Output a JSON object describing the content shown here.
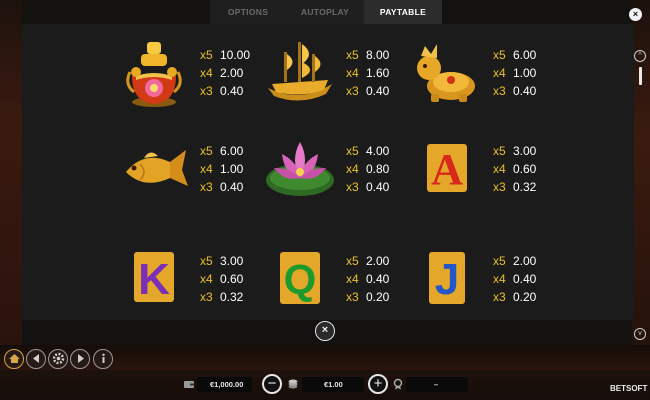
{
  "tabs": [
    {
      "label": "OPTIONS",
      "active": false
    },
    {
      "label": "AUTOPLAY",
      "active": false
    },
    {
      "label": "PAYTABLE",
      "active": true
    }
  ],
  "close_label": "×",
  "scroll": {
    "up": "^",
    "down": "v"
  },
  "paytable": [
    {
      "symbol": "gold-treasure-pot",
      "pays": [
        {
          "mult": "x5",
          "amount": "10.00"
        },
        {
          "mult": "x4",
          "amount": "2.00"
        },
        {
          "mult": "x3",
          "amount": "0.40"
        }
      ]
    },
    {
      "symbol": "golden-ship",
      "pays": [
        {
          "mult": "x5",
          "amount": "8.00"
        },
        {
          "mult": "x4",
          "amount": "1.60"
        },
        {
          "mult": "x3",
          "amount": "0.40"
        }
      ]
    },
    {
      "symbol": "golden-dragon-turtle",
      "pays": [
        {
          "mult": "x5",
          "amount": "6.00"
        },
        {
          "mult": "x4",
          "amount": "1.00"
        },
        {
          "mult": "x3",
          "amount": "0.40"
        }
      ]
    },
    {
      "symbol": "golden-koi-fish",
      "pays": [
        {
          "mult": "x5",
          "amount": "6.00"
        },
        {
          "mult": "x4",
          "amount": "1.00"
        },
        {
          "mult": "x3",
          "amount": "0.40"
        }
      ]
    },
    {
      "symbol": "pink-lotus",
      "pays": [
        {
          "mult": "x5",
          "amount": "4.00"
        },
        {
          "mult": "x4",
          "amount": "0.80"
        },
        {
          "mult": "x3",
          "amount": "0.40"
        }
      ]
    },
    {
      "symbol": "letter-a",
      "glyph": "A",
      "pays": [
        {
          "mult": "x5",
          "amount": "3.00"
        },
        {
          "mult": "x4",
          "amount": "0.60"
        },
        {
          "mult": "x3",
          "amount": "0.32"
        }
      ]
    },
    {
      "symbol": "letter-k",
      "glyph": "K",
      "pays": [
        {
          "mult": "x5",
          "amount": "3.00"
        },
        {
          "mult": "x4",
          "amount": "0.60"
        },
        {
          "mult": "x3",
          "amount": "0.32"
        }
      ]
    },
    {
      "symbol": "letter-q",
      "glyph": "Q",
      "pays": [
        {
          "mult": "x5",
          "amount": "2.00"
        },
        {
          "mult": "x4",
          "amount": "0.40"
        },
        {
          "mult": "x3",
          "amount": "0.20"
        }
      ]
    },
    {
      "symbol": "letter-j",
      "glyph": "J",
      "pays": [
        {
          "mult": "x5",
          "amount": "2.00"
        },
        {
          "mult": "x4",
          "amount": "0.40"
        },
        {
          "mult": "x3",
          "amount": "0.20"
        }
      ]
    }
  ],
  "controls": {
    "left_icons": [
      "home-icon",
      "back-icon",
      "settings-icon",
      "forward-icon",
      "info-icon"
    ],
    "balance": "€1,000.00",
    "bet": "€1.00",
    "minus": "−",
    "plus": "+",
    "win": "–",
    "brand": "BETSOFT"
  },
  "colors": {
    "multiplier": "#e9c12c",
    "panel": "#1b1b1b",
    "letter_a": "#d8281c",
    "letter_k": "#7a2fb6",
    "letter_q": "#1c9a2c",
    "letter_j": "#2456c8",
    "gold": "#e4a72a"
  }
}
